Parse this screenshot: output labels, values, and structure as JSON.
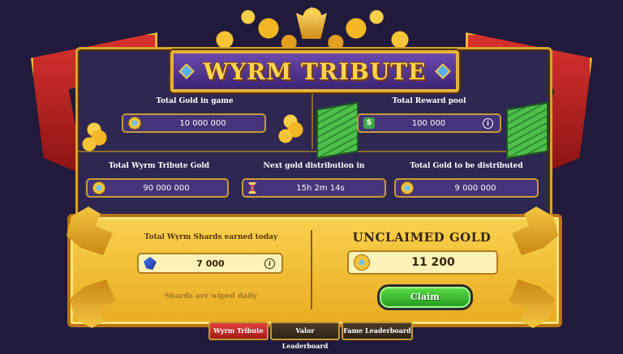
{
  "banner": {
    "title": "WYRM TRIBUTE"
  },
  "stats_top": {
    "total_gold_label": "Total Gold in game",
    "total_gold_value": "10 000 000",
    "reward_pool_label": "Total Reward pool",
    "reward_pool_value": "100 000"
  },
  "stats_mid": {
    "tribute_gold_label": "Total Wyrm Tribute Gold",
    "tribute_gold_value": "90 000 000",
    "next_distribution_label": "Next gold distribution in",
    "next_distribution_value": "15h 2m 14s",
    "to_distribute_label": "Total Gold to be distributed",
    "to_distribute_value": "9 000 000"
  },
  "shards": {
    "label": "Total Wyrm Shards earned today",
    "value": "7 000",
    "note": "Shards are wiped daily"
  },
  "unclaimed": {
    "title": "UNCLAIMED GOLD",
    "value": "11 200",
    "claim_label": "Claim"
  },
  "tabs": [
    {
      "label": "Wyrm Tribute",
      "active": true
    },
    {
      "label": "Valor Leaderboard",
      "active": false
    },
    {
      "label": "Fame Leaderboard",
      "active": false
    }
  ],
  "colors": {
    "background": "#211a3a",
    "panel": "#2e2752",
    "gold": "#e9ab21",
    "claim_green": "#1f9a1c",
    "active_tab": "#e0413a"
  },
  "icons": {
    "gold_coin": "gold-coin-icon",
    "reward_dollar": "dollar-icon",
    "timer": "hourglass-icon",
    "shard": "wyrm-shard-icon",
    "info": "info-icon"
  }
}
